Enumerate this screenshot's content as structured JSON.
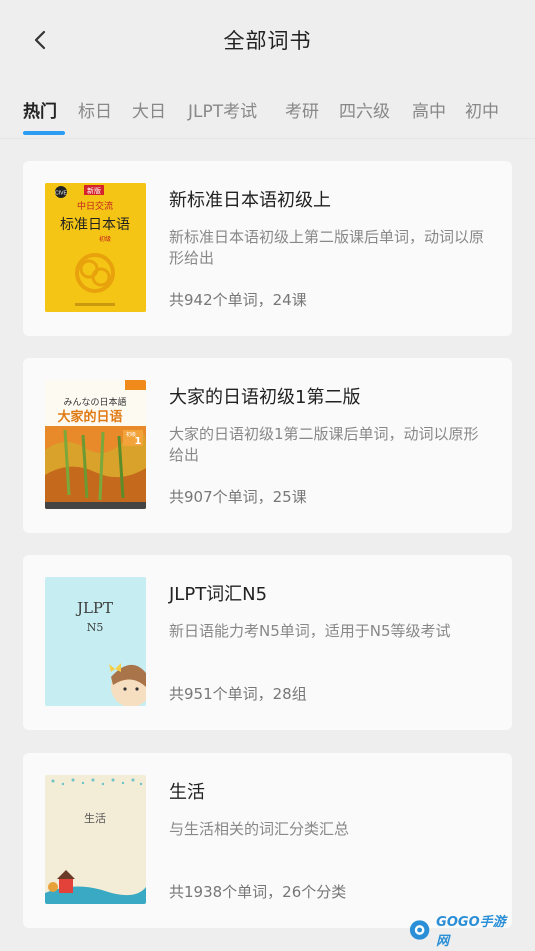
{
  "header": {
    "title": "全部词书"
  },
  "tabs": [
    {
      "label": "热门"
    },
    {
      "label": "标日"
    },
    {
      "label": "大日"
    },
    {
      "label": "JLPT考试"
    },
    {
      "label": "考研"
    },
    {
      "label": "四六级"
    },
    {
      "label": "高中"
    },
    {
      "label": "初中"
    }
  ],
  "books": [
    {
      "title": "新标准日本语初级上",
      "description": "新标准日本语初级上第二版课后单词，动词以原形给出",
      "stats": "共942个单词，24课",
      "cover": {
        "badge": "新版",
        "line1": "中日交流",
        "line2": "标准日本语",
        "sub": "初级",
        "tag": "CIVE",
        "color": "#f5c516"
      }
    },
    {
      "title": "大家的日语初级1第二版",
      "description": "大家的日语初级1第二版课后单词，动词以原形给出",
      "stats": "共907个单词，25课",
      "cover": {
        "line1": "みんなの日本語",
        "line2": "大家的日语",
        "level": "初级",
        "num": "1",
        "color": "#e88a2a"
      }
    },
    {
      "title": "JLPT词汇N5",
      "description": "新日语能力考N5单词，适用于N5等级考试",
      "stats": "共951个单词，28组",
      "cover": {
        "line1": "JLPT",
        "line2": "N5",
        "color": "#c6eef2"
      }
    },
    {
      "title": "生活",
      "description": "与生活相关的词汇分类汇总",
      "stats": "共1938个单词，26个分类",
      "cover": {
        "line1": "生活",
        "color": "#f3ecd6"
      }
    }
  ],
  "watermark": {
    "text": "GOGO手游网"
  },
  "colors": {
    "accent": "#2b9cf2",
    "background": "#eeeeee",
    "card": "#fafafa"
  }
}
